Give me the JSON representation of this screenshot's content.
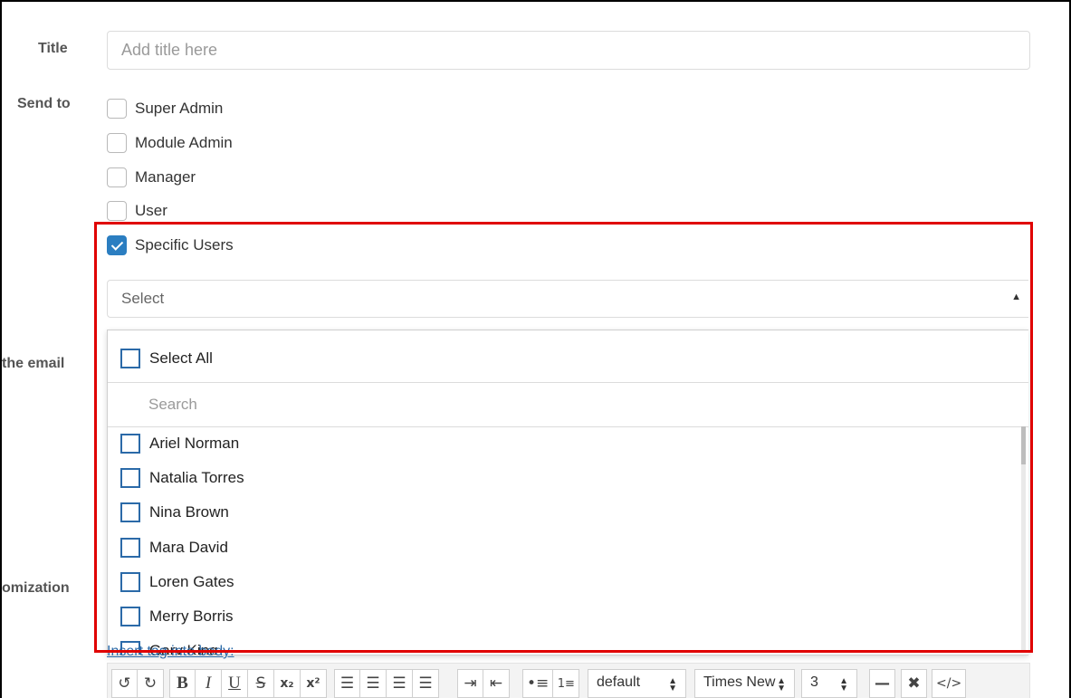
{
  "form": {
    "title_label": "Title",
    "title_placeholder": "Add title here",
    "sendto_label": "Send to",
    "email_label_partial": "the email",
    "custom_label_partial": "omization"
  },
  "roles": [
    {
      "label": "Super Admin",
      "checked": false
    },
    {
      "label": "Module Admin",
      "checked": false
    },
    {
      "label": "Manager",
      "checked": false
    },
    {
      "label": "User",
      "checked": false
    },
    {
      "label": "Specific Users",
      "checked": true
    }
  ],
  "user_select": {
    "placeholder": "Select",
    "caret_icon": "caret-up-icon",
    "select_all_label": "Select All",
    "search_placeholder": "Search",
    "users": [
      "Ariel Norman",
      "Natalia Torres",
      "Nina Brown",
      "Mara David",
      "Loren Gates",
      "Merry Borris",
      "Gary King"
    ]
  },
  "editor": {
    "insert_tag_link": "Insert tag into body:",
    "format_select": "default",
    "font_select": "Times New Roman",
    "size_select": "3"
  },
  "colors": {
    "accent": "#2b7ec1",
    "highlight": "#e00000"
  }
}
